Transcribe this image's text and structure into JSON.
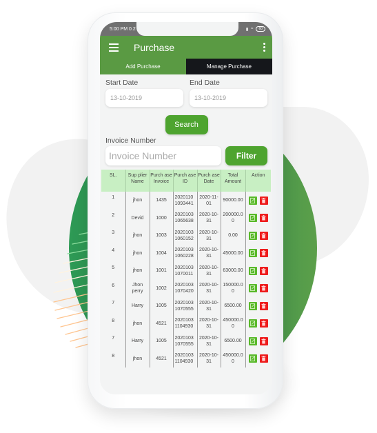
{
  "status_bar": {
    "time": "5:00 PM",
    "extra": "0.2",
    "battery": "60"
  },
  "app_bar": {
    "title": "Purchase"
  },
  "tabs": [
    {
      "label": "Add Purchase",
      "active": true
    },
    {
      "label": "Manage Purchase",
      "active": false
    }
  ],
  "form": {
    "start_date": {
      "label": "Start Date",
      "value": "13-10-2019"
    },
    "end_date": {
      "label": "End Date",
      "value": "13-10-2019"
    },
    "search_label": "Search",
    "invoice": {
      "label": "Invoice Number",
      "placeholder": "Invoice Number"
    },
    "filter_label": "Filter"
  },
  "table": {
    "headers": [
      "SL.",
      "Sup plier Name",
      "Purch ase Invoice",
      "Purch ase ID",
      "Purch ase Date",
      "Total Amount",
      "Action"
    ],
    "rows": [
      {
        "sl": "1",
        "supplier": "jhon",
        "invoice": "1435",
        "purchase_id": "2020110 1093441",
        "date": "2020-11- 01",
        "total": "90000.00"
      },
      {
        "sl": "2",
        "supplier": "Devid",
        "invoice": "1000",
        "purchase_id": "2020103 1065638",
        "date": "2020-10- 31",
        "total": "200000.0 0"
      },
      {
        "sl": "3",
        "supplier": "jhon",
        "invoice": "1003",
        "purchase_id": "2020103 1060152",
        "date": "2020-10- 31",
        "total": "0.00"
      },
      {
        "sl": "4",
        "supplier": "jhon",
        "invoice": "1004",
        "purchase_id": "2020103 1060228",
        "date": "2020-10- 31",
        "total": "45000.00"
      },
      {
        "sl": "5",
        "supplier": "jhon",
        "invoice": "1001",
        "purchase_id": "2020103 1070011",
        "date": "2020-10- 31",
        "total": "63000.00"
      },
      {
        "sl": "6",
        "supplier": "Jhon perry",
        "invoice": "1002",
        "purchase_id": "2020103 1070420",
        "date": "2020-10- 31",
        "total": "150000.0 0"
      },
      {
        "sl": "7",
        "supplier": "Harry",
        "invoice": "1005",
        "purchase_id": "2020103 1070555",
        "date": "2020-10- 31",
        "total": "6500.00"
      },
      {
        "sl": "8",
        "supplier": "jhon",
        "invoice": "4521",
        "purchase_id": "2020103 1104930",
        "date": "2020-10- 31",
        "total": "450000.0 0"
      },
      {
        "sl": "7",
        "supplier": "Harry",
        "invoice": "1005",
        "purchase_id": "2020103 1070555",
        "date": "2020-10- 31",
        "total": "6500.00"
      },
      {
        "sl": "8",
        "supplier": "jhon",
        "invoice": "4521",
        "purchase_id": "2020103 1104930",
        "date": "2020-10- 31",
        "total": "450000.0 0"
      }
    ],
    "actions": {
      "edit_icon": "edit-icon",
      "delete_icon": "trash-icon"
    }
  },
  "colors": {
    "primary_green": "#5a9a43",
    "button_green": "#4ea42f",
    "header_green": "#c8efc3",
    "dark_tab": "#15171b",
    "edit_green": "#59b92a",
    "delete_red": "#ee1c1c"
  }
}
